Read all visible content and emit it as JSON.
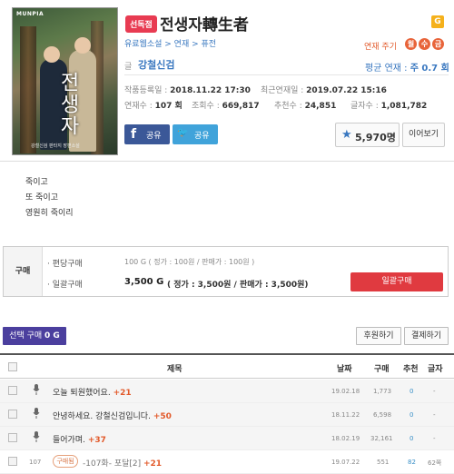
{
  "cover": {
    "publisher": "MUNPIA",
    "title_text": "전생자",
    "subtitle": "강철신검 판타지 장편소설"
  },
  "header": {
    "badge": "선독점",
    "title": "전생자轉生者",
    "grade_badge": "G",
    "category": "유료웹소설 > 연재 > 퓨전",
    "cycle_label": "연재 주기",
    "cycle_days": [
      "월",
      "수",
      "금"
    ],
    "writer_label": "글",
    "writer": "강철신검",
    "avg_label": "평균 연재 :",
    "avg_value": "주 0.7 회"
  },
  "stats": {
    "created_label": "작품등록일 :",
    "created": "2018.11.22 17:30",
    "latest_label": "최근연재일 :",
    "latest": "2019.07.22 15:16",
    "episodes_label": "연재수 :",
    "episodes": "107 회",
    "views_label": "조회수 :",
    "views": "669,817",
    "recommends_label": "추천수 :",
    "recommends": "24,851",
    "chars_label": "글자수 :",
    "chars": "1,081,782"
  },
  "social": {
    "facebook": "공유",
    "twitter": "공유"
  },
  "favorite": {
    "count": "5,970명"
  },
  "continue_label": "이어보기",
  "description": [
    "죽이고",
    "또 죽이고",
    "영원히 죽이리"
  ],
  "purchase": {
    "label": "구매",
    "per_episode_label": "· 편당구매",
    "per_episode_value": "100 G ( 정가 : 100원 / 판매가 : 100원 )",
    "bulk_label": "· 일괄구매",
    "bulk_value_bold": "3,500 G",
    "bulk_value_detail": "( 정가 : 3,500원 / 판매가 : 3,500원)",
    "bulk_button": "일괄구매"
  },
  "toolbar": {
    "select_buy": "선택 구매",
    "select_buy_count": "0 G",
    "support": "후원하기",
    "pay": "결제하기"
  },
  "table": {
    "headers": {
      "title": "제목",
      "date": "날짜",
      "buy": "구매",
      "recommend": "추천",
      "chars": "글자"
    },
    "rows": [
      {
        "num": "",
        "title": "오늘 퇴원했어요.",
        "plus": "+21",
        "date": "19.02.18",
        "views": "1,773",
        "rec": "0",
        "chars": "-",
        "type": "notice"
      },
      {
        "num": "",
        "title": "안녕하세요. 강철신검입니다.",
        "plus": "+50",
        "date": "18.11.22",
        "views": "6,598",
        "rec": "0",
        "chars": "-",
        "type": "notice"
      },
      {
        "num": "",
        "title": "들어가며.",
        "plus": "+37",
        "date": "18.02.19",
        "views": "32,161",
        "rec": "0",
        "chars": "-",
        "type": "notice"
      },
      {
        "num": "107",
        "badge": "구매됨",
        "title": "-107화- 포달[2]",
        "plus": "+21",
        "date": "19.07.22",
        "views": "551",
        "rec": "82",
        "chars": "62쪽",
        "type": "episode"
      }
    ]
  }
}
